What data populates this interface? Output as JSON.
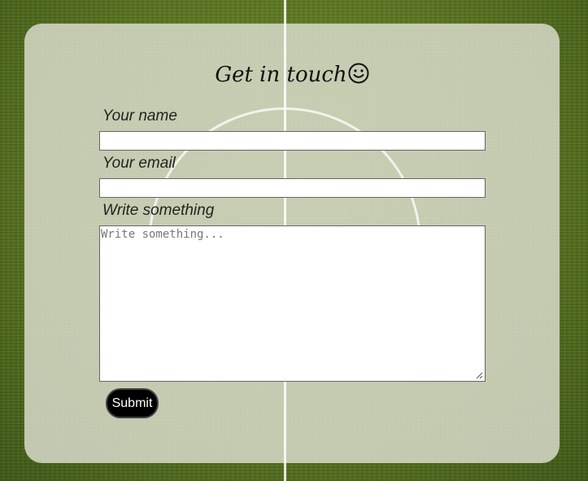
{
  "form": {
    "title": "Get in touch",
    "title_icon": "smiley-face-icon",
    "name_label": "Your name",
    "name_value": "",
    "email_label": "Your email",
    "email_value": "",
    "message_label": "Write something",
    "message_placeholder": "Write something...",
    "message_value": "",
    "submit_label": "Submit"
  },
  "colors": {
    "card_background": "#cfd3c0",
    "submit_background": "#000000",
    "submit_text": "#ffffff",
    "pitch_green": "#5a7520"
  }
}
